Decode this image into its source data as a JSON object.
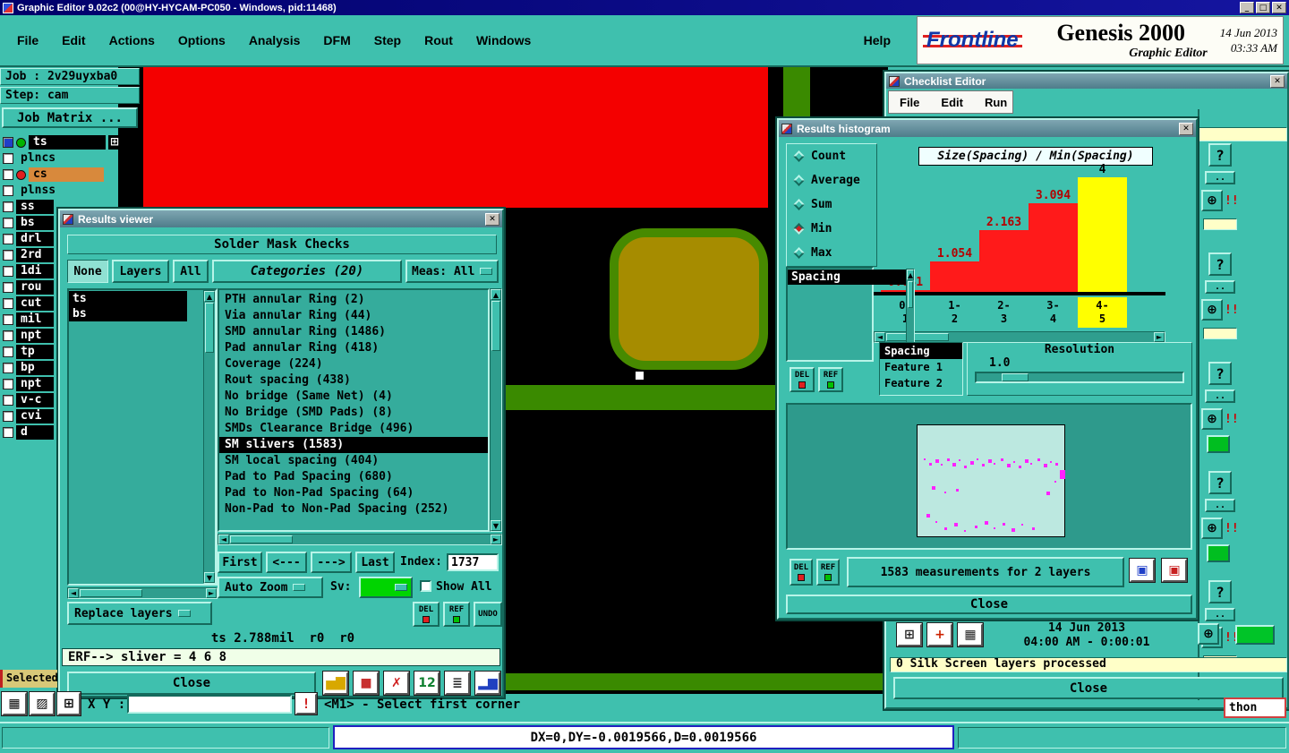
{
  "window": {
    "title": "Graphic Editor 9.02c2 (00@HY-HYCAM-PC050 - Windows, pid:11468)",
    "controls": [
      "_",
      "□",
      "✕"
    ]
  },
  "menubar": {
    "items": [
      "File",
      "Edit",
      "Actions",
      "Options",
      "Analysis",
      "DFM",
      "Step",
      "Rout",
      "Windows"
    ],
    "help": "Help"
  },
  "brand": {
    "logo": "Frontline",
    "product": "Genesis 2000",
    "subtitle": "Graphic Editor",
    "date": "14 Jun 2013",
    "time": "03:33 AM"
  },
  "job_panel": {
    "job": "Job : 2v29uyxba0",
    "step": "Step: cam",
    "matrix": "Job Matrix ..."
  },
  "layers": [
    {
      "name": "ts",
      "style": "dark wide",
      "dot": "#00B400",
      "check": "blue",
      "grid": true
    },
    {
      "name": "plncs",
      "style": "plain"
    },
    {
      "name": "cs",
      "style": "tan",
      "dot": "#E02020"
    },
    {
      "name": "plnss",
      "style": "plain"
    },
    {
      "name": "ss",
      "style": "dark"
    },
    {
      "name": "bs",
      "style": "dark"
    },
    {
      "name": "drl",
      "style": "dark"
    },
    {
      "name": "2rd",
      "style": "dark"
    },
    {
      "name": "1di",
      "style": "dark"
    },
    {
      "name": "rou",
      "style": "dark"
    },
    {
      "name": "cut",
      "style": "dark"
    },
    {
      "name": "mil",
      "style": "dark"
    },
    {
      "name": "npt",
      "style": "dark"
    },
    {
      "name": "tp",
      "style": "dark"
    },
    {
      "name": "bp",
      "style": "dark"
    },
    {
      "name": "npt",
      "style": "dark"
    },
    {
      "name": "v-c",
      "style": "dark"
    },
    {
      "name": "cvi",
      "style": "dark"
    },
    {
      "name": "d",
      "style": "dark"
    }
  ],
  "checklist": {
    "title": "Checklist Editor",
    "menu": [
      "File",
      "Edit",
      "Run"
    ]
  },
  "results_viewer": {
    "title": "Results viewer",
    "header": "Solder Mask Checks",
    "filter_buttons": [
      "None",
      "Layers",
      "All"
    ],
    "categories_label": "Categories (20)",
    "meas_label": "Meas:",
    "meas_value": "All",
    "layer_list": [
      "ts",
      "bs"
    ],
    "categories": [
      "PTH annular Ring (2)",
      "Via annular Ring (44)",
      "SMD annular Ring (1486)",
      "Pad annular Ring (418)",
      "Coverage (224)",
      "Rout spacing (438)",
      "No bridge (Same Net) (4)",
      "No Bridge (SMD Pads) (8)",
      "SMDs Clearance Bridge (496)",
      "SM slivers (1583)",
      "SM local spacing (404)",
      "Pad to Pad Spacing (680)",
      "Pad to Non-Pad Spacing (64)",
      "Non-Pad to Non-Pad Spacing (252)"
    ],
    "selected_category": "SM slivers (1583)",
    "nav": {
      "first": "First",
      "prev": "<---",
      "next": "--->",
      "last": "Last",
      "index_label": "Index:",
      "index_value": "1737"
    },
    "auto_zoom": "Auto Zoom",
    "sv_label": "Sv:",
    "show_all": "Show All",
    "replace_layers": "Replace layers",
    "buttons": {
      "del": "DEL",
      "ref": "REF",
      "undo": "UNDO"
    },
    "status": "ts 2.788mil  r0  r0",
    "erf": "ERF--> sliver = 4 6 8",
    "close": "Close",
    "toolbar_icons": [
      {
        "name": "histogram-icon",
        "glyph": "▅▇",
        "color": "#D8A800"
      },
      {
        "name": "fill-red-icon",
        "glyph": "■",
        "color": "#C83030"
      },
      {
        "name": "delete-results-icon",
        "glyph": "✗",
        "color": "#D02020"
      },
      {
        "name": "count-icon",
        "glyph": "12",
        "color": "#108030"
      },
      {
        "name": "report-icon",
        "glyph": "≣",
        "color": "#303030"
      },
      {
        "name": "graph-icon",
        "glyph": "▂▆",
        "color": "#2040C0"
      }
    ]
  },
  "histogram": {
    "title": "Results histogram",
    "stats": [
      "Count",
      "Average",
      "Sum",
      "Min",
      "Max"
    ],
    "selected_stat": "Min",
    "list_items": [
      "Spacing"
    ],
    "feature_rows": [
      "Spacing",
      "Feature 1",
      "Feature 2"
    ],
    "feature_selected": "Spacing",
    "resolution_label": "Resolution",
    "resolution_value": "1.0",
    "del": "DEL",
    "ref": "REF",
    "measurements": "1583 measurements for 2 layers",
    "close": "Close",
    "icon_buttons": [
      {
        "name": "overlay-blue-icon",
        "glyph": "▣",
        "color": "#2040C8"
      },
      {
        "name": "overlay-red-icon",
        "glyph": "▣",
        "color": "#C82020"
      }
    ]
  },
  "chart_data": {
    "type": "bar",
    "title": "Size(Spacing) / Min(Spacing)",
    "categories": [
      "0-1",
      "1-2",
      "2-3",
      "3-4",
      "4-5"
    ],
    "values": [
      0.031,
      1.054,
      2.163,
      3.094,
      4
    ],
    "value_labels": [
      "0.031",
      "1.054",
      "2.163",
      "3.094",
      "4"
    ],
    "bar_colors": [
      "#FF1A1A",
      "#FF1A1A",
      "#FF1A1A",
      "#FF1A1A",
      "#FFFF00"
    ],
    "label_colors": [
      "#B40000",
      "#B40000",
      "#B40000",
      "#B40000",
      "#000000"
    ],
    "ylim": [
      0,
      4
    ],
    "xlabel": "",
    "ylabel": "",
    "highlight_category": "4-5"
  },
  "right_toolbar": {
    "help_glyph": "?",
    "dots_glyph": "..",
    "zoom_glyph": "⊕",
    "warn_glyph": "!!",
    "groups": [
      {
        "extra": null
      },
      {
        "extra": null
      },
      {
        "extra": "green"
      },
      {
        "extra": "green"
      },
      {
        "extra": null
      }
    ]
  },
  "status_panel": {
    "date": "14 Jun 2013",
    "time": "04:00 AM - 0:00:01",
    "message": "0 Silk Screen layers processed",
    "close": "Close",
    "tool_icons": [
      {
        "name": "select-tool-icon",
        "glyph": "⊞",
        "color": "#222222"
      },
      {
        "name": "measure-tool-icon",
        "glyph": "+",
        "color": "#CC2200"
      },
      {
        "name": "pattern-tool-icon",
        "glyph": "▦",
        "color": "#222222"
      }
    ]
  },
  "bottom": {
    "selected_tag": "Selected",
    "xy_label": "X Y :",
    "alert_glyph": "!",
    "hint": "<M1> - Select first corner",
    "coords": "DX=0,DY=-0.0019566,D=0.0019566",
    "python_button": "thon"
  }
}
